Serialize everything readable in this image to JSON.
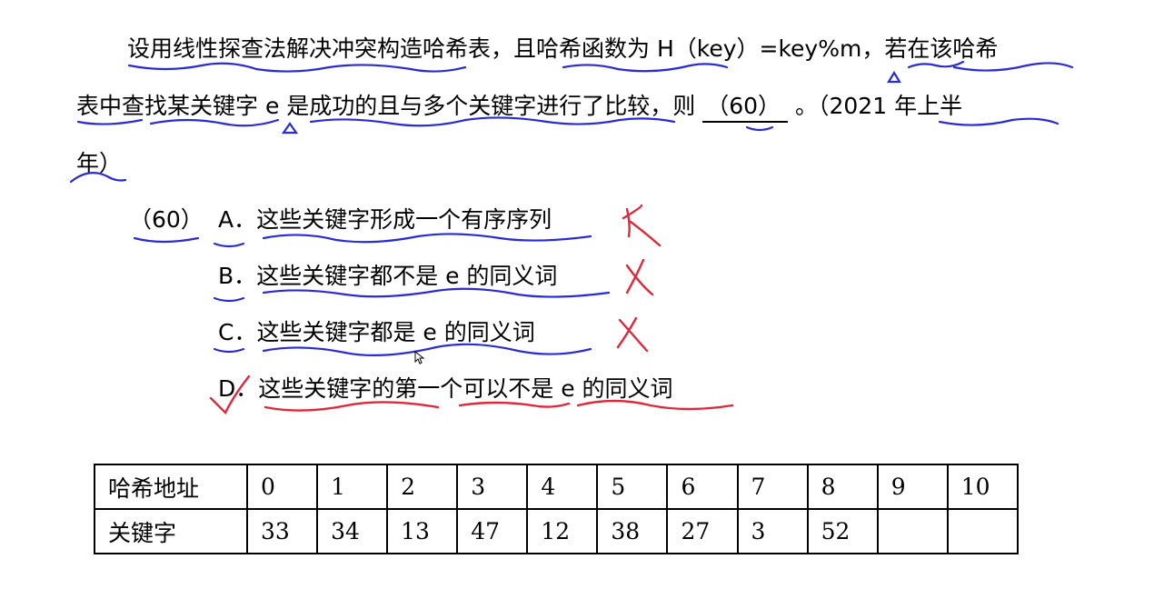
{
  "question": {
    "line1": "设用线性探查法解决冲突构造哈希表，且哈希函数为 H（key）=key%m，若在该哈希",
    "line2_pre": "表中查找某关键字 e 是成功的且与多个关键字进行了比较，则",
    "blank": "（60）",
    "line2_post": "。（2021 年上半",
    "line3": "年）"
  },
  "options": {
    "number": "（60）",
    "items": [
      {
        "letter": "A．",
        "text": "这些关键字形成一个有序序列"
      },
      {
        "letter": "B．",
        "text": "这些关键字都不是 e 的同义词"
      },
      {
        "letter": "C．",
        "text": "这些关键字都是 e 的同义词"
      },
      {
        "letter": "D．",
        "text": "这些关键字的第一个可以不是 e 的同义词"
      }
    ]
  },
  "table": {
    "row1_label": "哈希地址",
    "row2_label": "关键字",
    "addresses": [
      "0",
      "1",
      "2",
      "3",
      "4",
      "5",
      "6",
      "7",
      "8",
      "9",
      "10"
    ],
    "keys": [
      "33",
      "34",
      "13",
      "47",
      "12",
      "38",
      "27",
      "3",
      "52",
      "",
      ""
    ]
  },
  "colors": {
    "blue_ink": "#2b2bd6",
    "red_ink": "#e0283a"
  }
}
